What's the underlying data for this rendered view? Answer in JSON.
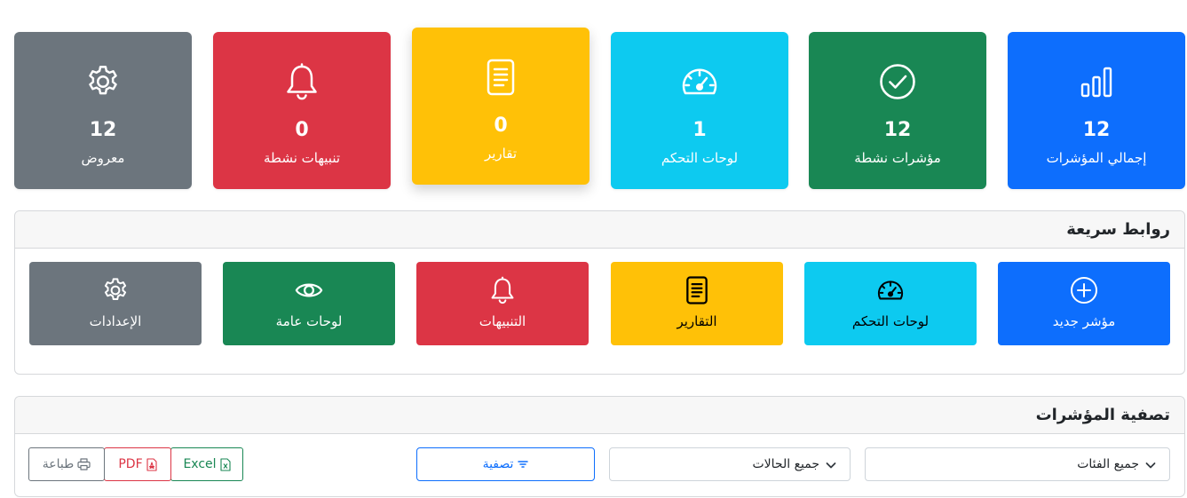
{
  "stats": {
    "total": {
      "value": "12",
      "label": "إجمالي المؤشرات",
      "icon": "bar-chart-icon"
    },
    "active": {
      "value": "12",
      "label": "مؤشرات نشطة",
      "icon": "check-circle-icon"
    },
    "dashboards": {
      "value": "1",
      "label": "لوحات التحكم",
      "icon": "speedometer-icon"
    },
    "reports": {
      "value": "0",
      "label": "تقارير",
      "icon": "document-icon"
    },
    "alerts": {
      "value": "0",
      "label": "تنبيهات نشطة",
      "icon": "bell-icon"
    },
    "displayed": {
      "value": "12",
      "label": "معروض",
      "icon": "gear-icon"
    }
  },
  "quick_links": {
    "title": "روابط سريعة",
    "new_indicator": "مؤشر جديد",
    "dashboards": "لوحات التحكم",
    "reports": "التقارير",
    "alerts": "التنبيهات",
    "public_dashboards": "لوحات عامة",
    "settings": "الإعدادات"
  },
  "filter": {
    "title": "تصفية المؤشرات",
    "category_select": "جميع الفئات",
    "status_select": "جميع الحالات",
    "filter_button": "تصفية",
    "excel_button": "Excel",
    "pdf_button": "PDF",
    "print_button": "طباعة"
  },
  "colors": {
    "primary": "#0d6efd",
    "success": "#198754",
    "info": "#0dcaf0",
    "warning": "#ffc107",
    "danger": "#dc3545",
    "secondary": "#6c757d"
  }
}
